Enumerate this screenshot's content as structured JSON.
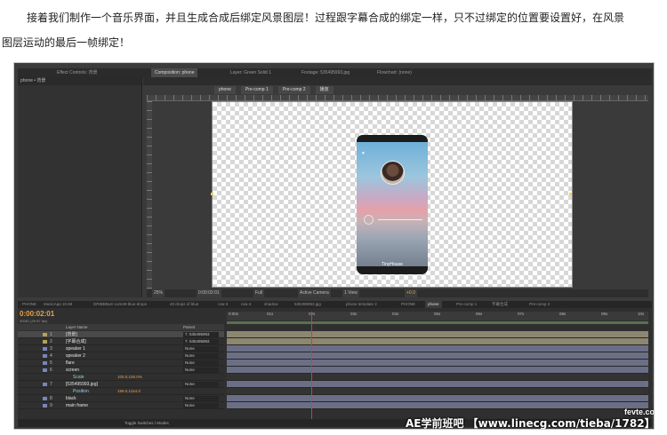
{
  "article": {
    "line1": "接着我们制作一个音乐界面，并且生成合成后绑定风景图层！过程跟字幕合成的绑定一样，只不过绑定的位置要设置好，在风景",
    "line2": "图层运动的最后一帧绑定！"
  },
  "ae": {
    "top_tabs": [
      "Effect Controls: 背景",
      "Composition: phone",
      "Layer: Green Solid 1",
      "Footage: 535495993.jpg",
      "Flowchart: (none)"
    ],
    "left_panel_header": "phone • 背景",
    "comp_tab": "phone",
    "breadcrumbs": [
      "phone",
      "Pre-comp 1",
      "Pre-comp 2",
      "播放"
    ],
    "phone_title": "TinyHouse",
    "footer_items": [
      "25%",
      "0:00:02:01",
      "Full",
      "Active Camera",
      "1 View",
      "+0.0"
    ],
    "timeline_tabs": [
      "PHONE",
      "MusicApp 10.69",
      "DRIBBBLE-com49-blue-drops",
      "40 drops of blue",
      "row-3",
      "row-4",
      "shadow",
      "535495993.jpg",
      "phone template 2",
      "PHONE",
      "phone",
      "Pre-comp 1",
      "字幕合成",
      "Pre-comp 2"
    ],
    "timecode": "0:00:02:01",
    "fps": "00061 (29.97 fps)",
    "layer_header": "Layer Name",
    "parent_header": "Parent",
    "layers": [
      {
        "num": "1",
        "name": "[背景]",
        "parent": "7. 535495993",
        "color": "#b7a05a"
      },
      {
        "num": "2",
        "name": "[字幕合成]",
        "parent": "7. 535495993",
        "color": "#b7a05a"
      },
      {
        "num": "3",
        "name": "speaker 1",
        "parent": "None",
        "color": "#7b84b8"
      },
      {
        "num": "4",
        "name": "speaker 2",
        "parent": "None",
        "color": "#7b84b8"
      },
      {
        "num": "5",
        "name": "flare",
        "parent": "None",
        "color": "#7b84b8"
      },
      {
        "num": "6",
        "name": "screen",
        "parent": "None",
        "color": "#7b84b8"
      },
      {
        "sub": true,
        "name": "Scale",
        "val": "100.0,100.0%"
      },
      {
        "num": "7",
        "name": "[535495993.jpg]",
        "parent": "None",
        "color": "#7b84b8"
      },
      {
        "sub": true,
        "name": "Position",
        "val": "199.0,1154.0"
      },
      {
        "num": "8",
        "name": "black",
        "parent": "None",
        "color": "#7b84b8"
      },
      {
        "num": "9",
        "name": "main frame",
        "parent": "None",
        "color": "#7b84b8"
      }
    ],
    "ruler_ticks": [
      "0:00s",
      "01s",
      "02s",
      "03s",
      "04s",
      "05s",
      "06s",
      "07s",
      "08s",
      "09s",
      "10s"
    ],
    "tl_footer": "Toggle Switches / Modes"
  },
  "watermark": "AE学前班吧 【www.linecg.com/tieba/1782】",
  "wm_logo": "fevte.com"
}
